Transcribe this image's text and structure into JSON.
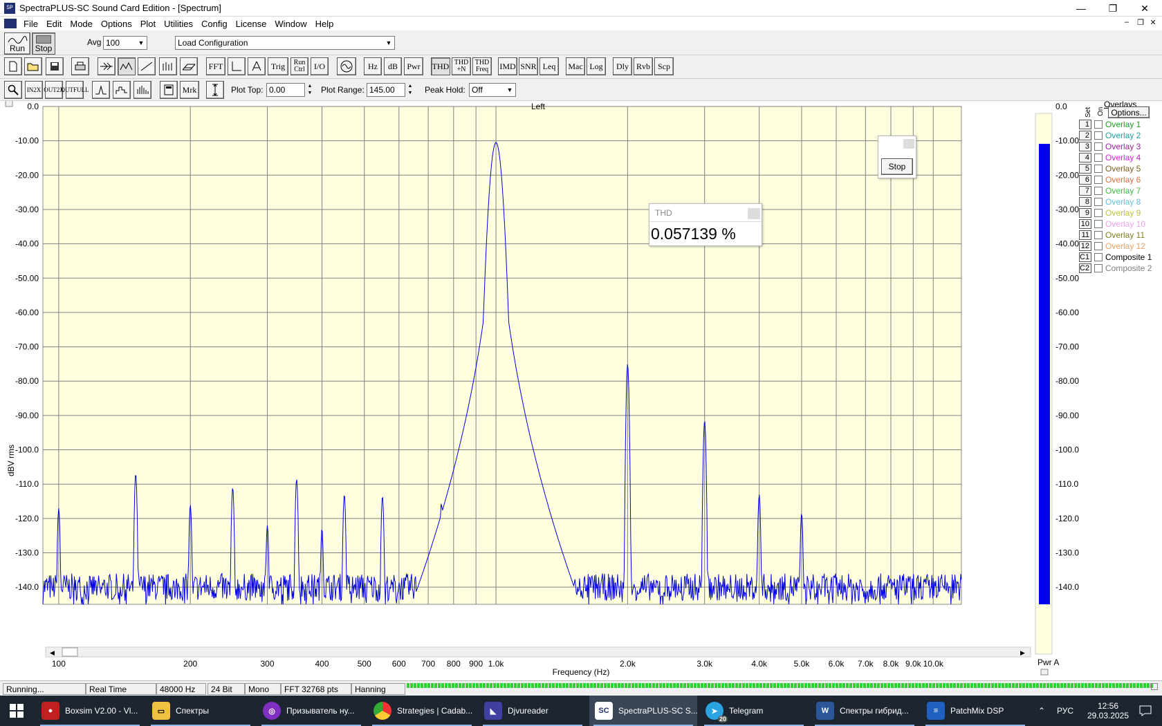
{
  "window": {
    "title": "SpectraPLUS-SC Sound Card Edition - [Spectrum]",
    "min_glyph": "—",
    "max_glyph": "❐",
    "close_glyph": "✕"
  },
  "menu": [
    "File",
    "Edit",
    "Mode",
    "Options",
    "Plot",
    "Utilities",
    "Config",
    "License",
    "Window",
    "Help"
  ],
  "toolbar1": {
    "run_label": "Run",
    "stop_label": "Stop",
    "avg_label": "Avg",
    "avg_value": "100",
    "config_value": "Load Configuration"
  },
  "toolbar2": {
    "text_buttons": [
      "FFT",
      "Trig",
      "Run Ctrl",
      "I/O",
      "Hz",
      "dB",
      "Pwr",
      "THD",
      "THD +N",
      "THD Freq",
      "IMD",
      "SNR",
      "Leq",
      "Mac",
      "Log",
      "Dly",
      "Rvb",
      "Scp"
    ]
  },
  "toolbar3": {
    "mrk_label": "Mrk",
    "plot_top_label": "Plot Top:",
    "plot_top_value": "0.00",
    "plot_range_label": "Plot Range:",
    "plot_range_value": "145.00",
    "peak_hold_label": "Peak Hold:",
    "peak_hold_value": "Off"
  },
  "chart_data": {
    "type": "line",
    "title": "Left",
    "xlabel": "Frequency (Hz)",
    "ylabel": "dBV rms",
    "xscale": "log",
    "xlim": [
      92,
      11600
    ],
    "ylim": [
      -145,
      0
    ],
    "grid": true,
    "line_color": "#0000dd",
    "background": "#ffffe0",
    "x_ticks": [
      {
        "v": 100,
        "label": "100"
      },
      {
        "v": 200,
        "label": "200"
      },
      {
        "v": 300,
        "label": "300"
      },
      {
        "v": 400,
        "label": "400"
      },
      {
        "v": 500,
        "label": "500"
      },
      {
        "v": 600,
        "label": "600"
      },
      {
        "v": 700,
        "label": "700"
      },
      {
        "v": 800,
        "label": "800"
      },
      {
        "v": 900,
        "label": "900"
      },
      {
        "v": 1000,
        "label": "1.0k"
      },
      {
        "v": 2000,
        "label": "2.0k"
      },
      {
        "v": 3000,
        "label": "3.0k"
      },
      {
        "v": 4000,
        "label": "4.0k"
      },
      {
        "v": 5000,
        "label": "5.0k"
      },
      {
        "v": 6000,
        "label": "6.0k"
      },
      {
        "v": 7000,
        "label": "7.0k"
      },
      {
        "v": 8000,
        "label": "8.0k"
      },
      {
        "v": 9000,
        "label": "9.0k"
      },
      {
        "v": 10000,
        "label": "10.0k"
      }
    ],
    "y_ticks": [
      "0.0",
      "-10.00",
      "-20.00",
      "-30.00",
      "-40.00",
      "-50.00",
      "-60.00",
      "-70.00",
      "-80.00",
      "-90.00",
      "-100.0",
      "-110.0",
      "-120.0",
      "-130.0",
      "-140.0"
    ],
    "noise_floor_db": -140,
    "peaks": [
      {
        "x": 100,
        "y": -117
      },
      {
        "x": 150,
        "y": -107
      },
      {
        "x": 200,
        "y": -116
      },
      {
        "x": 250,
        "y": -111
      },
      {
        "x": 300,
        "y": -122
      },
      {
        "x": 350,
        "y": -108.5
      },
      {
        "x": 400,
        "y": -123
      },
      {
        "x": 450,
        "y": -113
      },
      {
        "x": 550,
        "y": -113.5
      },
      {
        "x": 750,
        "y": -115.5
      },
      {
        "x": 900,
        "y": -121
      },
      {
        "x": 1000,
        "y": -10.5
      },
      {
        "x": 2000,
        "y": -75
      },
      {
        "x": 3000,
        "y": -91.5
      },
      {
        "x": 4000,
        "y": -113
      },
      {
        "x": 5000,
        "y": -118.5
      }
    ]
  },
  "meter": {
    "label": "Pwr A",
    "level_db": -9,
    "y_ticks": [
      "0.0",
      "-10.00",
      "-20.00",
      "-30.00",
      "-40.00",
      "-50.00",
      "-60.00",
      "-70.00",
      "-80.00",
      "-90.00",
      "-100.0",
      "-110.0",
      "-120.0",
      "-130.0",
      "-140.0"
    ],
    "color": "#0000ee"
  },
  "thd_popup": {
    "title": "THD",
    "value": "0.057139 %"
  },
  "stop_popup": {
    "button": "Stop"
  },
  "overlays": {
    "title": "Overlays",
    "set_label": "Set",
    "on_label": "On",
    "options_label": "Options...",
    "items": [
      {
        "num": "1",
        "name": "Overlay 1",
        "color": "#20a020"
      },
      {
        "num": "2",
        "name": "Overlay 2",
        "color": "#20a0a0"
      },
      {
        "num": "3",
        "name": "Overlay 3",
        "color": "#a020a0"
      },
      {
        "num": "4",
        "name": "Overlay 4",
        "color": "#e020e0"
      },
      {
        "num": "5",
        "name": "Overlay 5",
        "color": "#806020"
      },
      {
        "num": "6",
        "name": "Overlay 6",
        "color": "#e07040"
      },
      {
        "num": "7",
        "name": "Overlay 7",
        "color": "#40c040"
      },
      {
        "num": "8",
        "name": "Overlay 8",
        "color": "#60c0e0"
      },
      {
        "num": "9",
        "name": "Overlay 9",
        "color": "#c0c040"
      },
      {
        "num": "10",
        "name": "Overlay 10",
        "color": "#f0a0f0"
      },
      {
        "num": "11",
        "name": "Overlay 11",
        "color": "#808020"
      },
      {
        "num": "12",
        "name": "Overlay 12",
        "color": "#f0a060"
      },
      {
        "num": "C1",
        "name": "Composite 1",
        "color": "#000000"
      },
      {
        "num": "C2",
        "name": "Composite 2",
        "color": "#808080"
      }
    ]
  },
  "status": [
    "Running...",
    "Real Time",
    "48000 Hz",
    "24 Bit",
    "Mono",
    "FFT 32768 pts",
    "Hanning"
  ],
  "taskbar": {
    "items": [
      "Boxsim V2.00 - Vl...",
      "Спектры",
      "Призыватель ну...",
      "Strategies | Cadab...",
      "Djvureader",
      "SpectraPLUS-SC S...",
      "Telegram",
      "Спектры гибрид...",
      "PatchMix DSP"
    ],
    "telegram_badge": "20",
    "lang": "РУС",
    "time": "12:56",
    "date": "29.03.2025"
  }
}
